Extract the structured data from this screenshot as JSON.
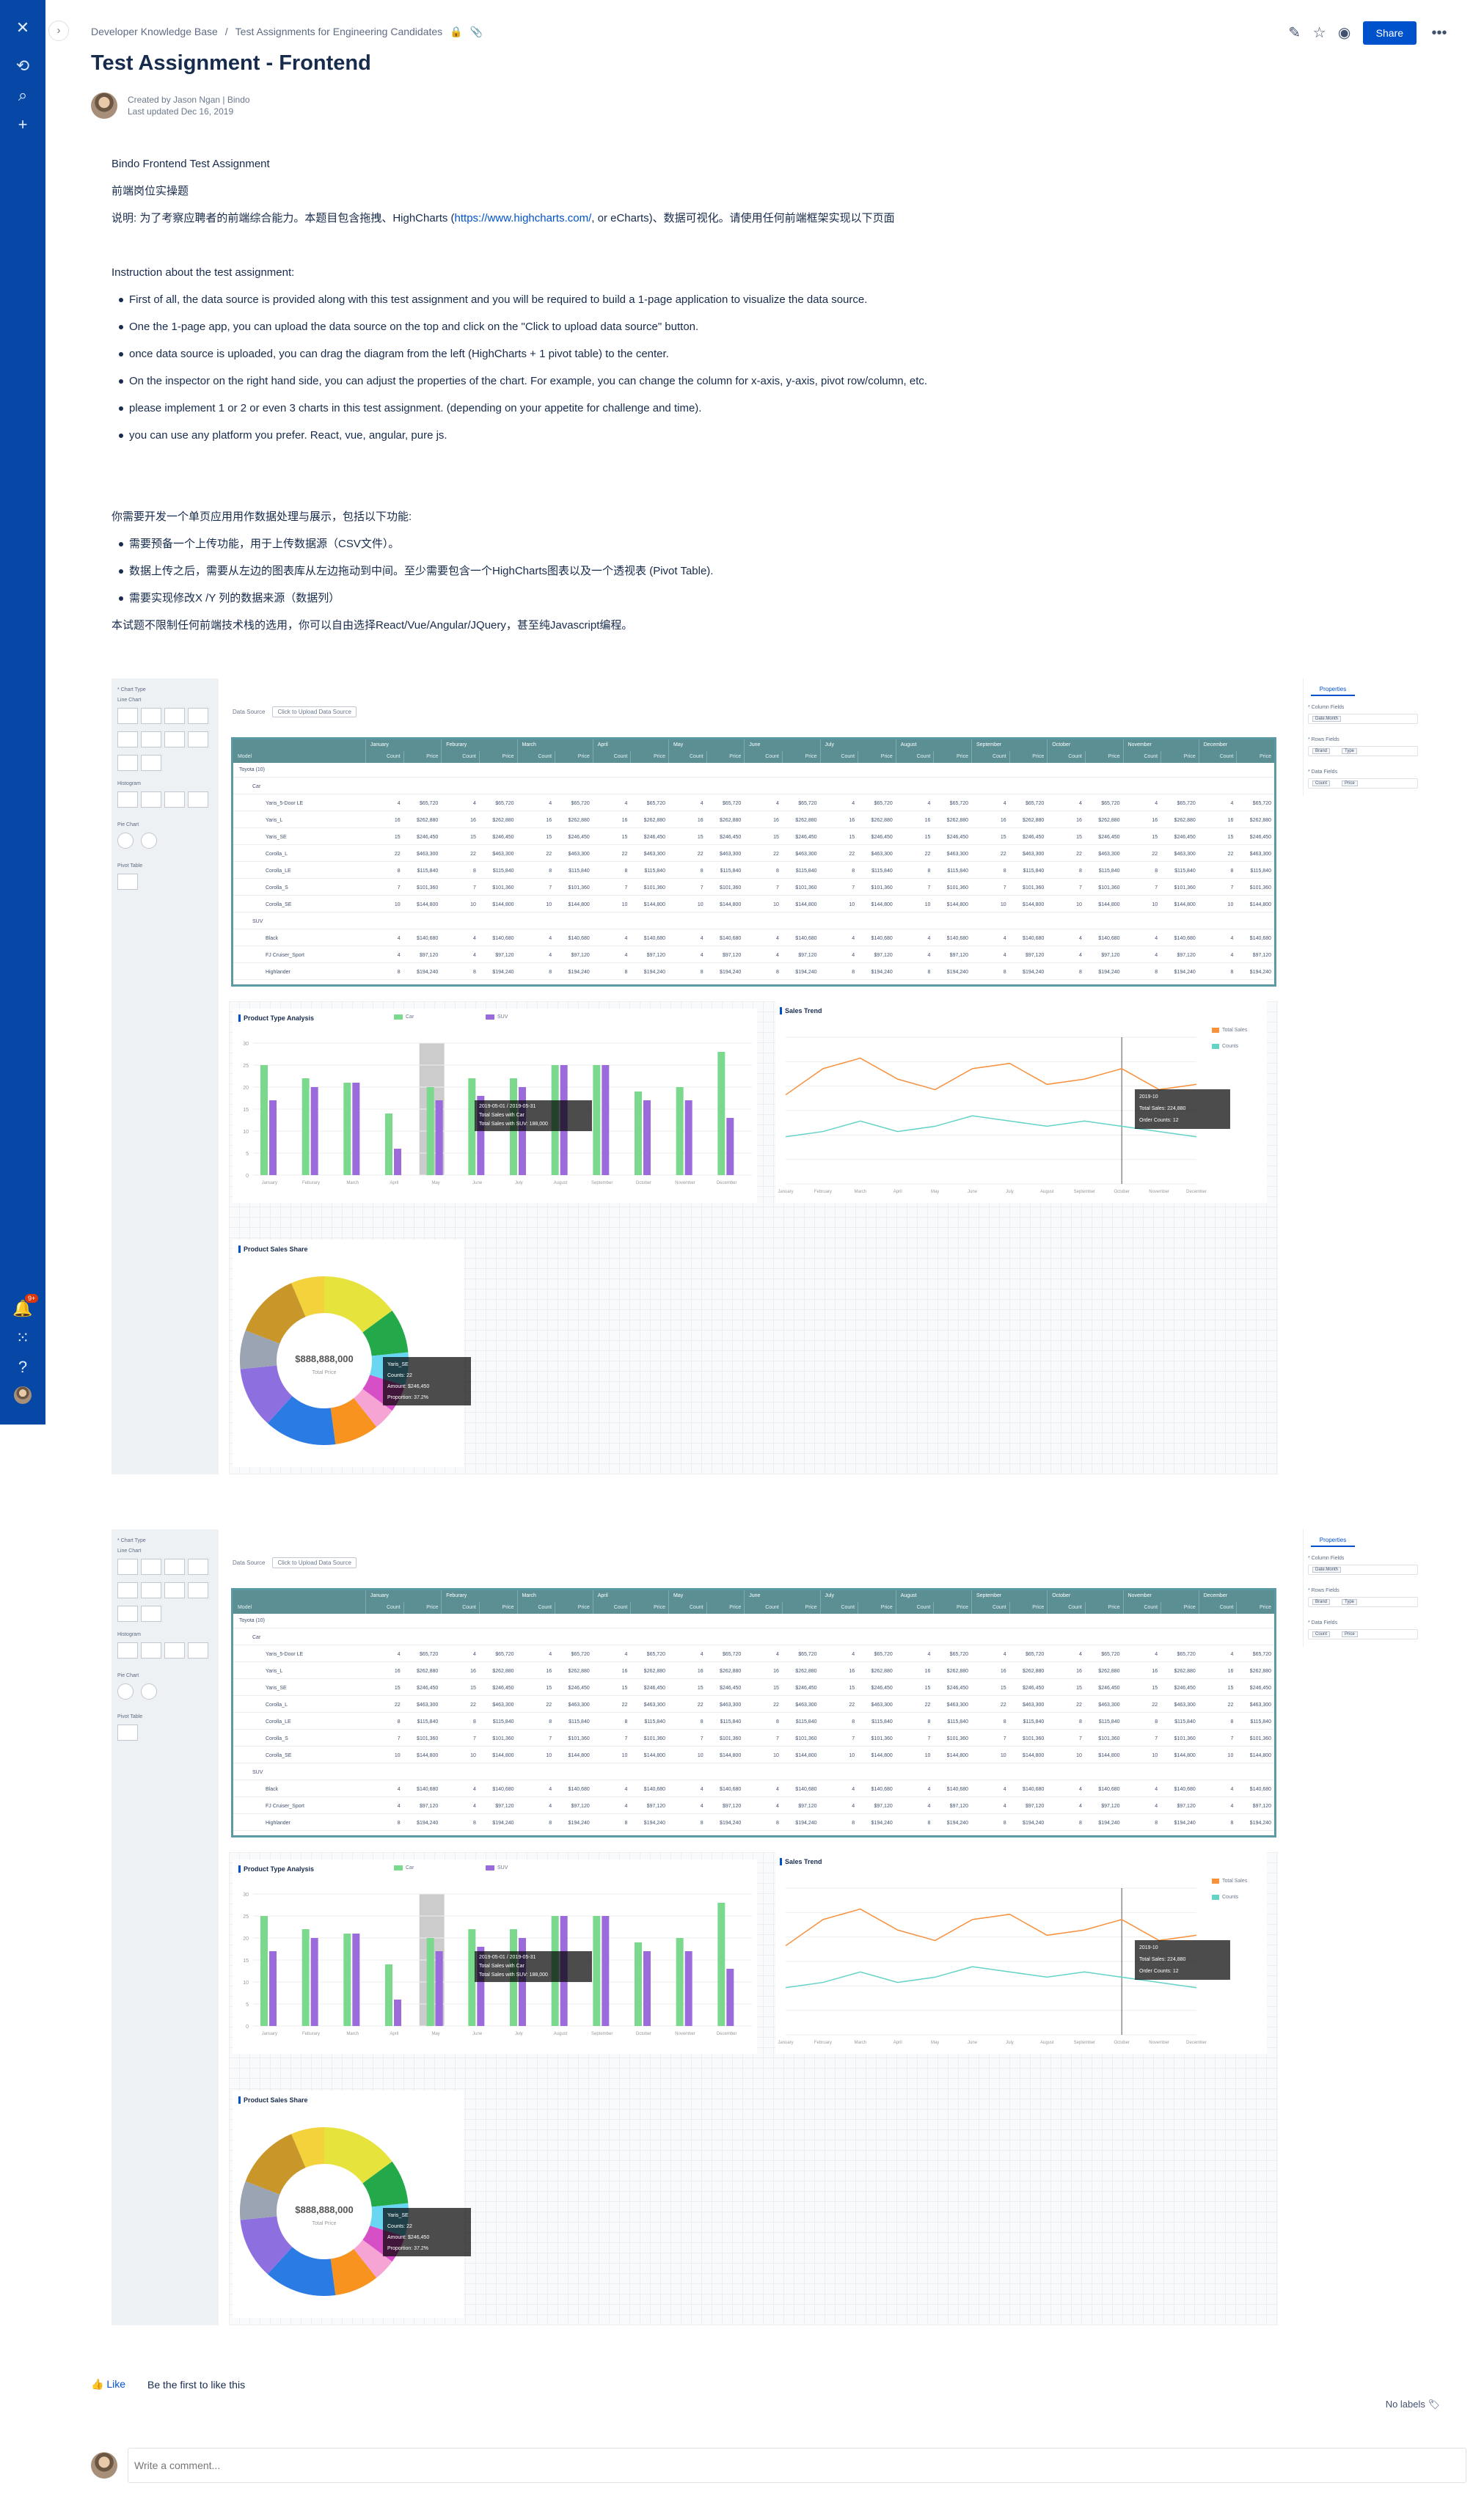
{
  "sidebar": {
    "icons": [
      "confluence-logo-icon",
      "recent-icon",
      "search-icon",
      "create-icon"
    ],
    "bottom_icons": [
      "notification-icon",
      "app-switcher-icon",
      "help-icon",
      "profile-avatar"
    ],
    "notif_badge": "9+"
  },
  "breadcrumb": {
    "space": "Developer Knowledge Base",
    "parent": "Test Assignments for Engineering Candidates"
  },
  "toolbar": {
    "share_label": "Share"
  },
  "page": {
    "title": "Test Assignment - Frontend",
    "created_by": "Created by Jason Ngan | Bindo",
    "last_updated": "Last updated Dec 16, 2019"
  },
  "content": {
    "p1": "Bindo Frontend Test Assignment",
    "p2": "前端岗位实操题",
    "p3_pre": "说明: 为了考察应聘者的前端综合能力。本题目包含拖拽、HighCharts (",
    "p3_link": "https://www.highcharts.com/",
    "p3_post": ", or eCharts)、数据可视化。请使用任何前端框架实现以下页面",
    "instr": "Instruction about the test assignment:",
    "en_items": [
      "First of all, the data source is provided along with this test assignment and you will be required to build a 1-page application to visualize the data source.",
      "One the 1-page app, you can upload the data source on the top and click on the \"Click to upload data source\" button.",
      "once data source is uploaded, you can drag the diagram from the left (HighCharts + 1 pivot table) to the center.",
      "On the inspector on the right hand side, you can adjust the properties of the chart. For example, you can change the column for x-axis, y-axis, pivot row/column, etc.",
      "please implement 1 or 2 or even 3 charts in this test assignment. (depending on your appetite for challenge and time).",
      "you can use any platform you prefer. React, vue, angular, pure js."
    ],
    "cn_intro": "你需要开发一个单页应用用作数据处理与展示，包括以下功能:",
    "cn_items": [
      "需要预备一个上传功能，用于上传数据源（CSV文件）。",
      "数据上传之后，需要从左边的图表库从左边拖动到中间。至少需要包含一个HighCharts图表以及一个透视表 (Pivot Table).",
      "需要实现修改X /Y 列的数据来源（数据列）"
    ],
    "cn_outro": "本试题不限制任何前端技术栈的选用，你可以自由选择React/Vue/Angular/JQuery，甚至纯Javascript编程。"
  },
  "mockup": {
    "panel": {
      "chart_type": "* Chart Type",
      "line_chart": "Line Chart",
      "histogram": "Histogram",
      "pie_chart": "Pie Chart",
      "pivot_table": "Pivot Table"
    },
    "data_source": "Data Source",
    "upload_btn": "Click to Upload Data Source",
    "props": {
      "tab": "Properties",
      "column_fields": "* Column Fields",
      "rows_fields": "* Rows Fields",
      "data_fields": "* Data Fields",
      "col_tag": "Date.Month",
      "row_tags": [
        "Brand",
        "Type"
      ],
      "data_tags": [
        "Count",
        "Price"
      ]
    },
    "pivot": {
      "model": "Model",
      "count": "Count",
      "price": "Price",
      "months": [
        "January",
        "Feburary",
        "March",
        "April",
        "May",
        "June",
        "July",
        "August",
        "September",
        "October",
        "November",
        "December"
      ],
      "rows": [
        {
          "name": "Toyota (10)",
          "level": 0,
          "values": []
        },
        {
          "name": "Car",
          "level": 1,
          "values": []
        },
        {
          "name": "Yaris_5-Door LE",
          "level": 2,
          "values": [
            "4",
            "$65,720"
          ]
        },
        {
          "name": "Yaris_L",
          "level": 2,
          "values": [
            "16",
            "$262,880"
          ]
        },
        {
          "name": "Yaris_SE",
          "level": 2,
          "values": [
            "15",
            "$246,450"
          ]
        },
        {
          "name": "Corolla_L",
          "level": 2,
          "values": [
            "22",
            "$463,300"
          ]
        },
        {
          "name": "Corolla_LE",
          "level": 2,
          "values": [
            "8",
            "$115,840"
          ]
        },
        {
          "name": "Corolla_S",
          "level": 2,
          "values": [
            "7",
            "$101,360"
          ]
        },
        {
          "name": "Corolla_SE",
          "level": 2,
          "values": [
            "10",
            "$144,800"
          ]
        },
        {
          "name": "SUV",
          "level": 1,
          "values": []
        },
        {
          "name": "Black",
          "level": 2,
          "values": [
            "4",
            "$140,680"
          ]
        },
        {
          "name": "FJ Cruiser_Sport",
          "level": 2,
          "values": [
            "4",
            "$97,120"
          ]
        },
        {
          "name": "Highlander",
          "level": 2,
          "values": [
            "8",
            "$194,240"
          ]
        }
      ]
    },
    "charts": {
      "product_type": "Product Type Analysis",
      "sales_trend": "Sales Trend",
      "sales_share": "Product Sales Share"
    },
    "bar_tooltip": [
      "2019-05-01 / 2019-05-31",
      "Total Sales with Car",
      "Total Sales with SUV: 188,000"
    ],
    "line_tooltip": [
      "2019-10",
      "Total Sales: 224,880",
      "Order Counts: 12"
    ],
    "pie_center": "$888,888,000",
    "pie_center_sub": "Total Price",
    "pie_tooltip": [
      "Yaris_SE",
      "Counts: 22",
      "Amount: $246,450",
      "Proportion: 37.2%"
    ]
  },
  "chart_data": [
    {
      "type": "bar",
      "title": "Product Type Analysis",
      "categories": [
        "January",
        "Feburary",
        "March",
        "April",
        "May",
        "June",
        "July",
        "August",
        "September",
        "October",
        "November",
        "December"
      ],
      "series": [
        {
          "name": "Car",
          "values": [
            25,
            22,
            21,
            14,
            20,
            22,
            22,
            25,
            25,
            19,
            20,
            28
          ]
        },
        {
          "name": "SUV",
          "values": [
            17,
            20,
            21,
            6,
            17,
            18,
            20,
            25,
            25,
            17,
            17,
            13
          ]
        }
      ],
      "ylim": [
        0,
        30
      ],
      "colors": [
        "#7bd98e",
        "#9c6bdb"
      ]
    },
    {
      "type": "line",
      "title": "Sales Trend",
      "categories": [
        "January",
        "February",
        "March",
        "April",
        "May",
        "June",
        "July",
        "August",
        "September",
        "October",
        "November",
        "December"
      ],
      "series": [
        {
          "name": "Total Sales",
          "values": [
            17,
            22,
            24,
            20,
            18,
            22,
            23,
            19,
            20,
            22,
            18,
            19
          ]
        },
        {
          "name": "Counts",
          "values": [
            9,
            10,
            12,
            10,
            11,
            13,
            12,
            11,
            12,
            11,
            10,
            9
          ]
        }
      ],
      "colors": [
        "#f7913e",
        "#63d3c7"
      ]
    },
    {
      "type": "pie",
      "title": "Product Sales Share",
      "values": [
        14,
        8,
        6,
        5,
        4,
        8,
        13,
        11,
        7,
        12,
        6
      ],
      "colors": [
        "#e6e33d",
        "#23a94a",
        "#69d6f2",
        "#d64fc6",
        "#f5a4d3",
        "#f7931e",
        "#2a7be4",
        "#8e6fe0",
        "#9aa4b3",
        "#c9962a",
        "#f3d23b"
      ]
    }
  ]
}
